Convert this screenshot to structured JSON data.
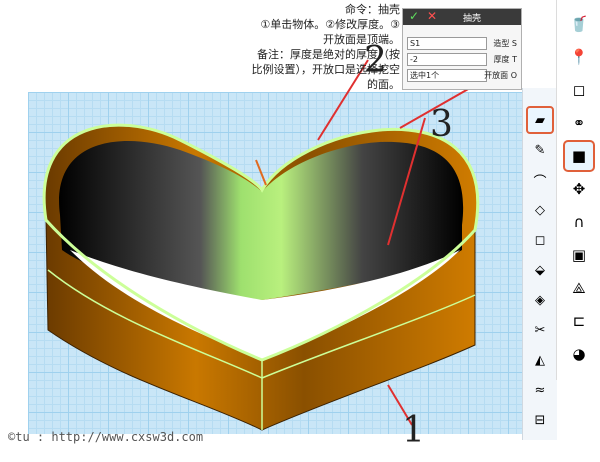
{
  "note": {
    "lines": [
      "命令：抽壳",
      "①单击物体。②修改厚度。③开放面是顶端。",
      "备注：厚度是绝对的厚度（按比例设置），开放口是选择挖空的面。"
    ]
  },
  "panel": {
    "title": "抽壳",
    "ok_icon": "✓",
    "cancel_icon": "✕",
    "rows": [
      {
        "label": "造型 S",
        "value": "S1"
      },
      {
        "label": "厚度 T",
        "value": "-2"
      },
      {
        "label": "开放面 O",
        "value": "选中1个"
      }
    ]
  },
  "callouts": [
    "1",
    "2",
    "3"
  ],
  "watermark": "©tu : http://www.cxsw3d.com",
  "toolbar": {
    "icons": [
      "cup-icon",
      "pin-icon",
      "shell-square-icon",
      "link-icon",
      "cube-icon",
      "move-icon",
      "magnet-icon",
      "box-icon",
      "network-icon",
      "ruler-icon",
      "color-icon"
    ],
    "glyphs": [
      "🥤",
      "📍",
      "◻",
      "⚭",
      "■",
      "✥",
      "∩",
      "▣",
      "⟁",
      "⊏",
      "◕"
    ]
  },
  "subtoolbar": {
    "icons": [
      "shell-icon",
      "extrude-icon",
      "fillet-icon",
      "chamfer-icon",
      "hollow-icon",
      "split-icon",
      "box-cut-icon",
      "trim-icon",
      "mirror-icon",
      "wave-icon",
      "plane-icon"
    ],
    "glyphs": [
      "▰",
      "✎",
      "⌒",
      "◇",
      "◻",
      "⬙",
      "◈",
      "✂",
      "◭",
      "≈",
      "⊟"
    ]
  },
  "colors": {
    "shell_outer": "#b86a00",
    "shell_inner": "#111111",
    "rim": "#ccff99"
  }
}
